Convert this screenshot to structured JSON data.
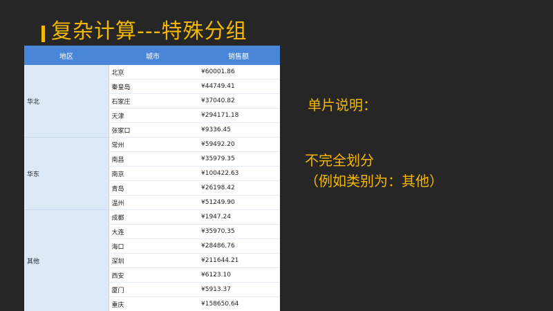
{
  "slide": {
    "title": "复杂计算---特殊分组",
    "note_heading": "单片说明：",
    "note_line1": "不完全划分",
    "note_line2": "（例如类别为：其他）"
  },
  "table": {
    "headers": [
      "地区",
      "城市",
      "销售额"
    ],
    "groups": [
      {
        "region": "华北",
        "rows": [
          {
            "city": "北京",
            "amount": "¥60001.86"
          },
          {
            "city": "秦皇岛",
            "amount": "¥44749.41"
          },
          {
            "city": "石家庄",
            "amount": "¥37040.82"
          },
          {
            "city": "天津",
            "amount": "¥294171.18"
          },
          {
            "city": "张家口",
            "amount": "¥9336.45"
          }
        ]
      },
      {
        "region": "华东",
        "rows": [
          {
            "city": "常州",
            "amount": "¥59492.20"
          },
          {
            "city": "南昌",
            "amount": "¥35979.35"
          },
          {
            "city": "南京",
            "amount": "¥100422.63"
          },
          {
            "city": "青岛",
            "amount": "¥26198.42"
          },
          {
            "city": "温州",
            "amount": "¥51249.90"
          }
        ]
      },
      {
        "region": "其他",
        "rows": [
          {
            "city": "成都",
            "amount": "¥1947.24"
          },
          {
            "city": "大连",
            "amount": "¥35970.35"
          },
          {
            "city": "海口",
            "amount": "¥28486.76"
          },
          {
            "city": "深圳",
            "amount": "¥211644.21"
          },
          {
            "city": "西安",
            "amount": "¥6123.10"
          },
          {
            "city": "厦门",
            "amount": "¥5913.37"
          },
          {
            "city": "重庆",
            "amount": "¥158650.64"
          }
        ]
      }
    ]
  }
}
